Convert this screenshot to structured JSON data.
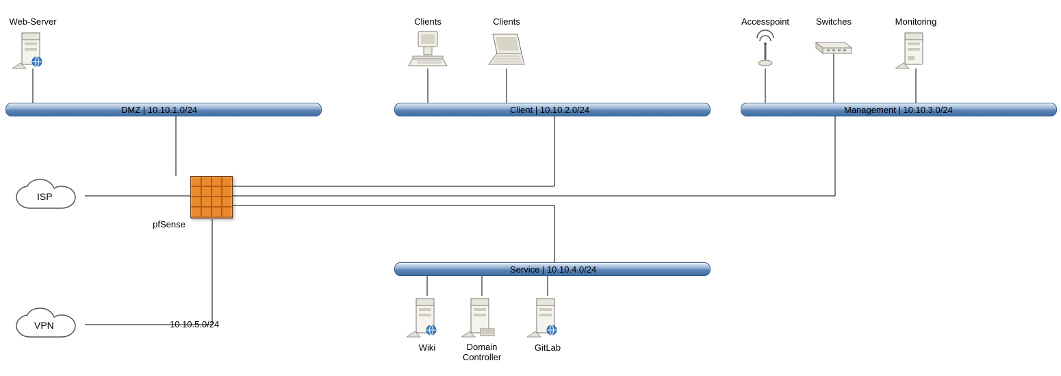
{
  "nodes": {
    "web_server": "Web-Server",
    "clients1": "Clients",
    "clients2": "Clients",
    "accesspoint": "Accesspoint",
    "switches": "Switches",
    "monitoring": "Monitoring",
    "pfsense": "pfSense",
    "isp": "ISP",
    "vpn": "VPN",
    "wiki": "Wiki",
    "domain_controller": "Domain\nController",
    "gitlab": "GitLab"
  },
  "segments": {
    "dmz": "DMZ | 10.10.1.0/24",
    "client": "Client | 10.10.2.0/24",
    "management": "Management | 10.10.3.0/24",
    "service": "Service | 10.10.4.0/24"
  },
  "links": {
    "vpn_subnet": "10.10.5.0/24"
  }
}
